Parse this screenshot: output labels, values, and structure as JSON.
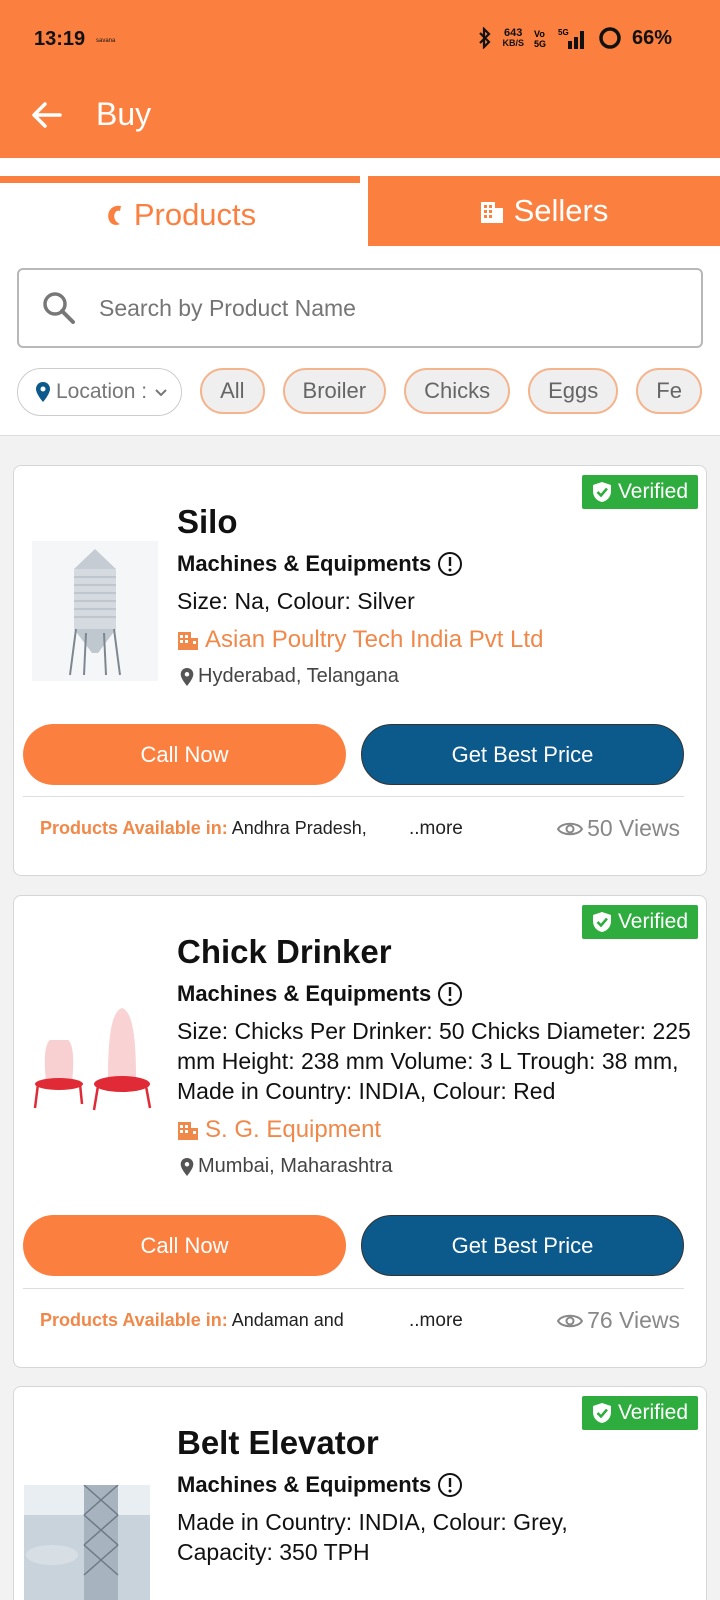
{
  "status_bar": {
    "time": "13:19",
    "carrier": "savana",
    "speed_value": "643",
    "speed_unit": "KB/S",
    "battery": "66%"
  },
  "app_bar": {
    "title": "Buy"
  },
  "tabs": [
    {
      "label": "Products",
      "active": true
    },
    {
      "label": "Sellers",
      "active": false
    }
  ],
  "search": {
    "placeholder": "Search by Product Name"
  },
  "filters": {
    "location_label": "Location :",
    "chips": [
      "All",
      "Broiler",
      "Chicks",
      "Eggs",
      "Fe"
    ]
  },
  "labels": {
    "verified": "Verified",
    "call_now": "Call Now",
    "get_best_price": "Get Best Price",
    "available_in": "Products Available in:",
    "more": "..more"
  },
  "products": [
    {
      "title": "Silo",
      "category": "Machines & Equipments",
      "description": "Size: Na, Colour: Silver",
      "seller": "Asian Poultry Tech India Pvt Ltd",
      "location": "Hyderabad, Telangana",
      "available_in": "Andhra Pradesh,",
      "views": "50 Views"
    },
    {
      "title": "Chick Drinker",
      "category": "Machines & Equipments",
      "description": "Size: Chicks Per Drinker: 50 Chicks Diameter: 225 mm Height: 238 mm Volume: 3 L Trough: 38 mm, Made in Country: INDIA, Colour: Red",
      "seller": "S. G. Equipment",
      "location": "Mumbai, Maharashtra",
      "available_in": "Andaman and",
      "views": "76 Views"
    },
    {
      "title": "Belt Elevator",
      "category": "Machines & Equipments",
      "description": "Made in Country: INDIA, Colour: Grey, Capacity: 350 TPH"
    }
  ],
  "colors": {
    "brand_orange": "#fb8040",
    "button_blue": "#0c5a8c",
    "verified_green": "#2eac3e"
  }
}
